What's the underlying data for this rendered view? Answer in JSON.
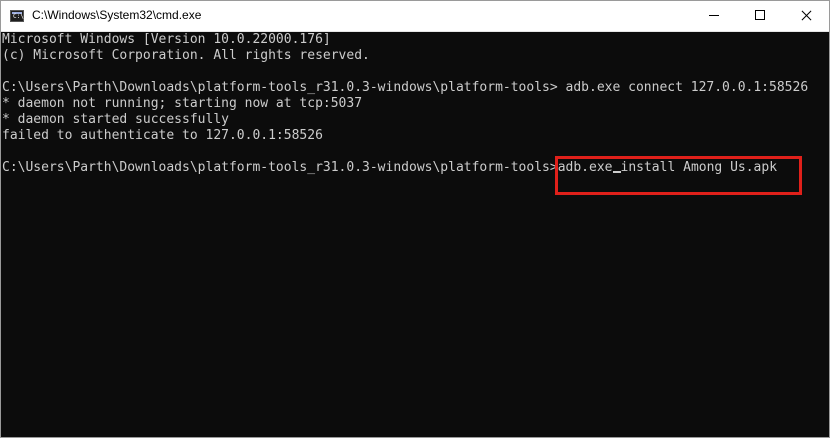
{
  "window": {
    "title": "C:\\Windows\\System32\\cmd.exe",
    "icon": "cmd-icon"
  },
  "console": {
    "lines": [
      "Microsoft Windows [Version 10.0.22000.176]",
      "(c) Microsoft Corporation. All rights reserved.",
      "",
      "C:\\Users\\Parth\\Downloads\\platform-tools_r31.0.3-windows\\platform-tools> adb.exe connect 127.0.0.1:58526",
      "* daemon not running; starting now at tcp:5037",
      "* daemon started successfully",
      "failed to authenticate to 127.0.0.1:58526",
      ""
    ],
    "current_prompt": "C:\\Users\\Parth\\Downloads\\platform-tools_r31.0.3-windows\\platform-tools>",
    "current_input_before_cursor": "adb.exe",
    "current_input_after_cursor": "install Among Us.apk"
  },
  "colors": {
    "console_background": "#0c0c0c",
    "console_text": "#cccccc",
    "highlight_border": "#e0201a"
  }
}
